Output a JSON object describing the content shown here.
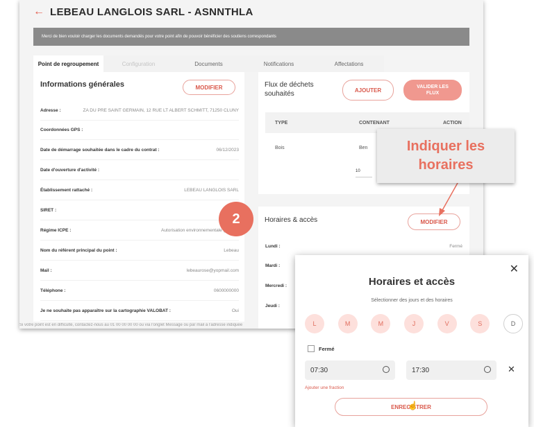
{
  "page": {
    "back_icon": "arrow-left-icon",
    "title": "LEBEAU LANGLOIS SARL - ASNNTHLA",
    "notice": "Merci de bien vouloir charger les documents demandés pour votre point afin de pouvoir bénéficier des soutiens correspondants",
    "footer": "Si votre point est en difficulté, contactez-nous au 01 00 00 00 00 ou via l'onglet Message ou par mail à l'adresse indiquée"
  },
  "tabs": [
    {
      "label": "Point de regroupement"
    },
    {
      "label": "Configuration"
    },
    {
      "label": "Documents"
    },
    {
      "label": "Notifications"
    },
    {
      "label": "Affectations"
    }
  ],
  "general_info": {
    "title": "Informations générales",
    "modify_label": "MODIFIER",
    "rows": [
      {
        "label": "Adresse :",
        "value": "ZA DU PRE SAINT GERMAIN, 12 RUE LT ALBERT SCHMITT, 71250 CLUNY"
      },
      {
        "label": "Coordonnées GPS :",
        "value": ""
      },
      {
        "label": "Date de démarrage souhaitée dans le cadre du contrat :",
        "value": "06/12/2023"
      },
      {
        "label": "Date d'ouverture d'activité :",
        "value": ""
      },
      {
        "label": "Établissement rattaché :",
        "value": "LEBEAU LANGLOIS SARL"
      },
      {
        "label": "SIRET :",
        "value": "444902"
      },
      {
        "label": "Régime ICPE :",
        "value": "Autorisation environnementale (Proces"
      },
      {
        "label": "Nom du référent principal du point :",
        "value": "Lebeau"
      },
      {
        "label": "Mail :",
        "value": "lebeaurose@yopmail.com"
      },
      {
        "label": "Téléphone :",
        "value": "0600000000"
      },
      {
        "label": "Je ne souhaite pas apparaître sur la cartographie VALOBAT :",
        "value": "Oui"
      }
    ]
  },
  "flux": {
    "title_line1": "Flux de déchets",
    "title_line2": "souhaités",
    "add_label": "AJOUTER",
    "validate_line1": "VALIDER LES",
    "validate_line2": "FLUX",
    "columns": [
      "TYPE",
      "CONTENANT",
      "ACTION"
    ],
    "rows": [
      {
        "type": "Bois",
        "container": "Ben"
      }
    ],
    "pager_value": "10"
  },
  "horaires": {
    "title": "Horaires & accès",
    "modify_label": "MODIFIER",
    "days": [
      {
        "label": "Lundi :",
        "value": "Fermé"
      },
      {
        "label": "Mardi :",
        "value": ""
      },
      {
        "label": "Mercredi :",
        "value": ""
      },
      {
        "label": "Jeudi :",
        "value": ""
      }
    ]
  },
  "annotation": {
    "badge": "2",
    "callout_line1": "Indiquer les",
    "callout_line2": "horaires",
    "color": "#e8705f"
  },
  "modal": {
    "title": "Horaires et accès",
    "subtitle": "Sélectionner des jours et des horaires",
    "close_icon": "close-icon",
    "days": [
      "L",
      "M",
      "M",
      "J",
      "V",
      "S",
      "D"
    ],
    "closed_label": "Fermé",
    "start_time": "07:30",
    "end_time": "17:30",
    "add_fraction": "Ajouter une fraction",
    "save_label": "ENREGISTRER"
  }
}
